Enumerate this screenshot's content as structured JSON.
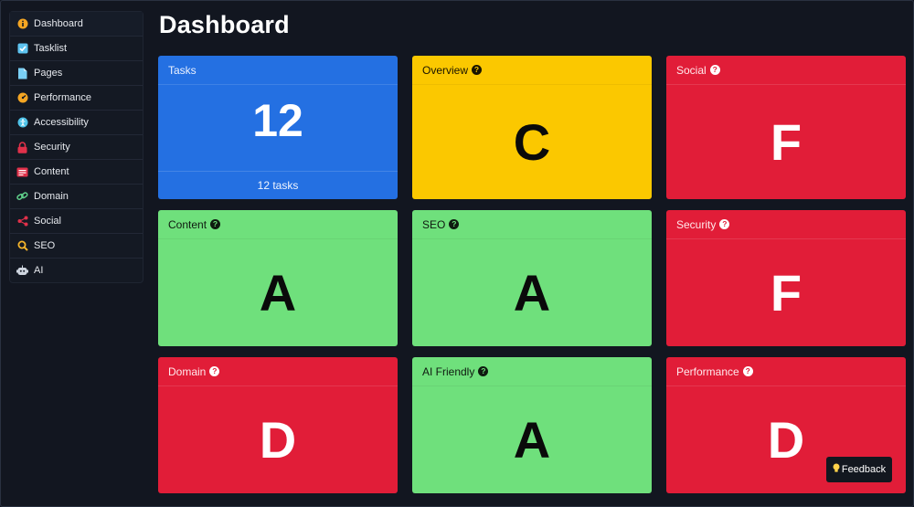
{
  "page": {
    "title": "Dashboard"
  },
  "sidebar": {
    "items": [
      {
        "label": "Dashboard",
        "icon": "info-icon",
        "color": "#f5a623"
      },
      {
        "label": "Tasklist",
        "icon": "checkbox-icon",
        "color": "#5ec4f0"
      },
      {
        "label": "Pages",
        "icon": "document-icon",
        "color": "#7ad0f5"
      },
      {
        "label": "Performance",
        "icon": "gauge-icon",
        "color": "#f5a623"
      },
      {
        "label": "Accessibility",
        "icon": "accessibility-icon",
        "color": "#4fc3e8"
      },
      {
        "label": "Security",
        "icon": "lock-icon",
        "color": "#e0314a"
      },
      {
        "label": "Content",
        "icon": "content-icon",
        "color": "#e0314a"
      },
      {
        "label": "Domain",
        "icon": "link-icon",
        "color": "#5fd08a"
      },
      {
        "label": "Social",
        "icon": "share-icon",
        "color": "#e0314a"
      },
      {
        "label": "SEO",
        "icon": "magnifier-icon",
        "color": "#f5b52b"
      },
      {
        "label": "AI",
        "icon": "robot-icon",
        "color": "#cfd6e0"
      }
    ]
  },
  "cards": {
    "tasks": {
      "title": "Tasks",
      "value": "12",
      "footer": "12 tasks",
      "color": "#2470e2"
    },
    "overview": {
      "title": "Overview",
      "grade": "C",
      "help": "?",
      "color": "#fbc800"
    },
    "social": {
      "title": "Social",
      "grade": "F",
      "help": "?",
      "color": "#e11d38"
    },
    "content": {
      "title": "Content",
      "grade": "A",
      "help": "?",
      "color": "#6fe07c"
    },
    "seo": {
      "title": "SEO",
      "grade": "A",
      "help": "?",
      "color": "#6fe07c"
    },
    "security": {
      "title": "Security",
      "grade": "F",
      "help": "?",
      "color": "#e11d38"
    },
    "domain": {
      "title": "Domain",
      "grade": "D",
      "help": "?",
      "color": "#e11d38"
    },
    "ai_friendly": {
      "title": "AI Friendly",
      "grade": "A",
      "help": "?",
      "color": "#6fe07c"
    },
    "performance": {
      "title": "Performance",
      "grade": "D",
      "help": "?",
      "color": "#e11d38"
    }
  },
  "feedback": {
    "label": "Feedback",
    "icon": "lightbulb-icon"
  }
}
